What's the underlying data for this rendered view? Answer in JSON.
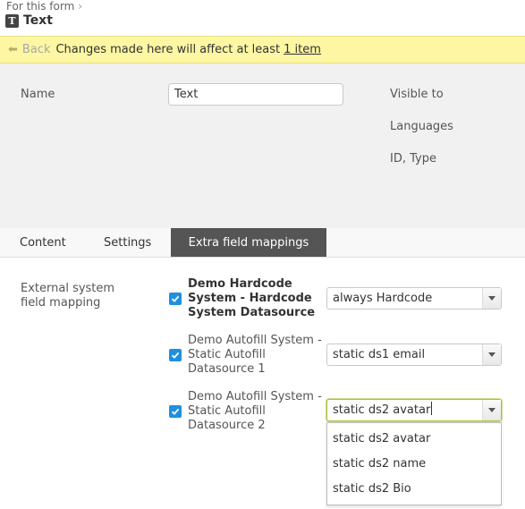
{
  "breadcrumb": {
    "label": "For this form"
  },
  "header": {
    "type_icon": "T",
    "title": "Text"
  },
  "warning": {
    "back_label": "Back",
    "message": "Changes made here will affect at least",
    "link_text": "1 item",
    "color": "#fdf6a3"
  },
  "properties": {
    "name_label": "Name",
    "name_value": "Text",
    "visible_to_label": "Visible to",
    "languages_label": "Languages",
    "id_type_label": "ID, Type"
  },
  "tabs": [
    {
      "label": "Content",
      "active": false
    },
    {
      "label": "Settings",
      "active": false
    },
    {
      "label": "Extra field mappings",
      "active": true
    }
  ],
  "mapping": {
    "section_label": "External system field mapping",
    "rows": [
      {
        "system": "Demo Hardcode System - Hardcode System Datasource",
        "checked": true,
        "selected": "always Hardcode"
      },
      {
        "system": "Demo Autofill System - Static Autofill Datasource 1",
        "checked": true,
        "selected": "static ds1 email"
      },
      {
        "system": "Demo Autofill System - Static Autofill Datasource 2",
        "checked": true,
        "selected": "static ds2 avatar"
      }
    ],
    "dropdown_options": [
      "static ds2 avatar",
      "static ds2 name",
      "static ds2 Bio"
    ]
  },
  "colors": {
    "accent": "#1f8fe0",
    "active_tab": "#555555",
    "focus": "#a6c23a"
  }
}
